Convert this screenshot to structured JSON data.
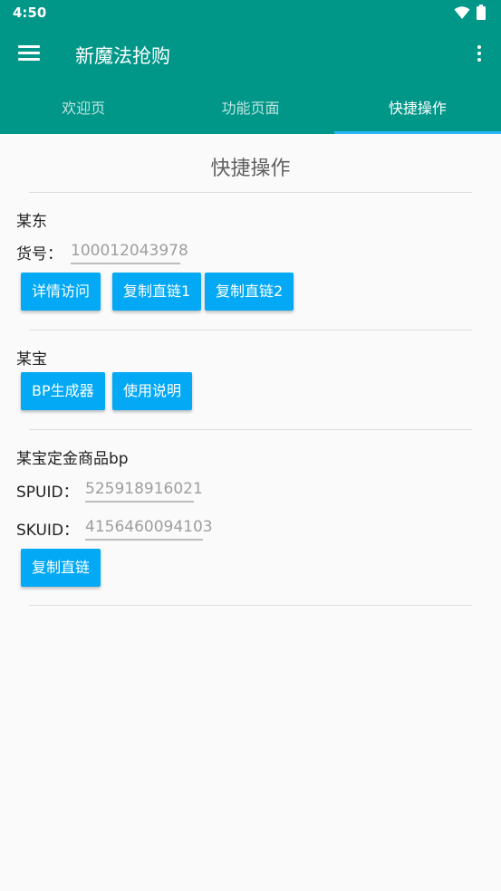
{
  "status": {
    "time": "4:50"
  },
  "app": {
    "title": "新魔法抢购"
  },
  "tabs": [
    {
      "label": "欢迎页"
    },
    {
      "label": "功能页面"
    },
    {
      "label": "快捷操作"
    }
  ],
  "page": {
    "title": "快捷操作"
  },
  "jd": {
    "title": "某东",
    "item_label": "货号：",
    "item_value": "100012043978",
    "buttons": [
      "详情访问",
      "复制直链1",
      "复制直链2"
    ]
  },
  "taobao": {
    "title": "某宝",
    "buttons": [
      "BP生成器",
      "使用说明"
    ]
  },
  "deposit": {
    "title": "某宝定金商品bp",
    "spuid_label": "SPUID：",
    "spuid_value": "525918916021",
    "skuid_label": "SKUID：",
    "skuid_value": "4156460094103",
    "button": "复制直链"
  },
  "colors": {
    "primary": "#009688",
    "accent": "#03a9f4",
    "tab_indicator": "#29b6f6"
  }
}
